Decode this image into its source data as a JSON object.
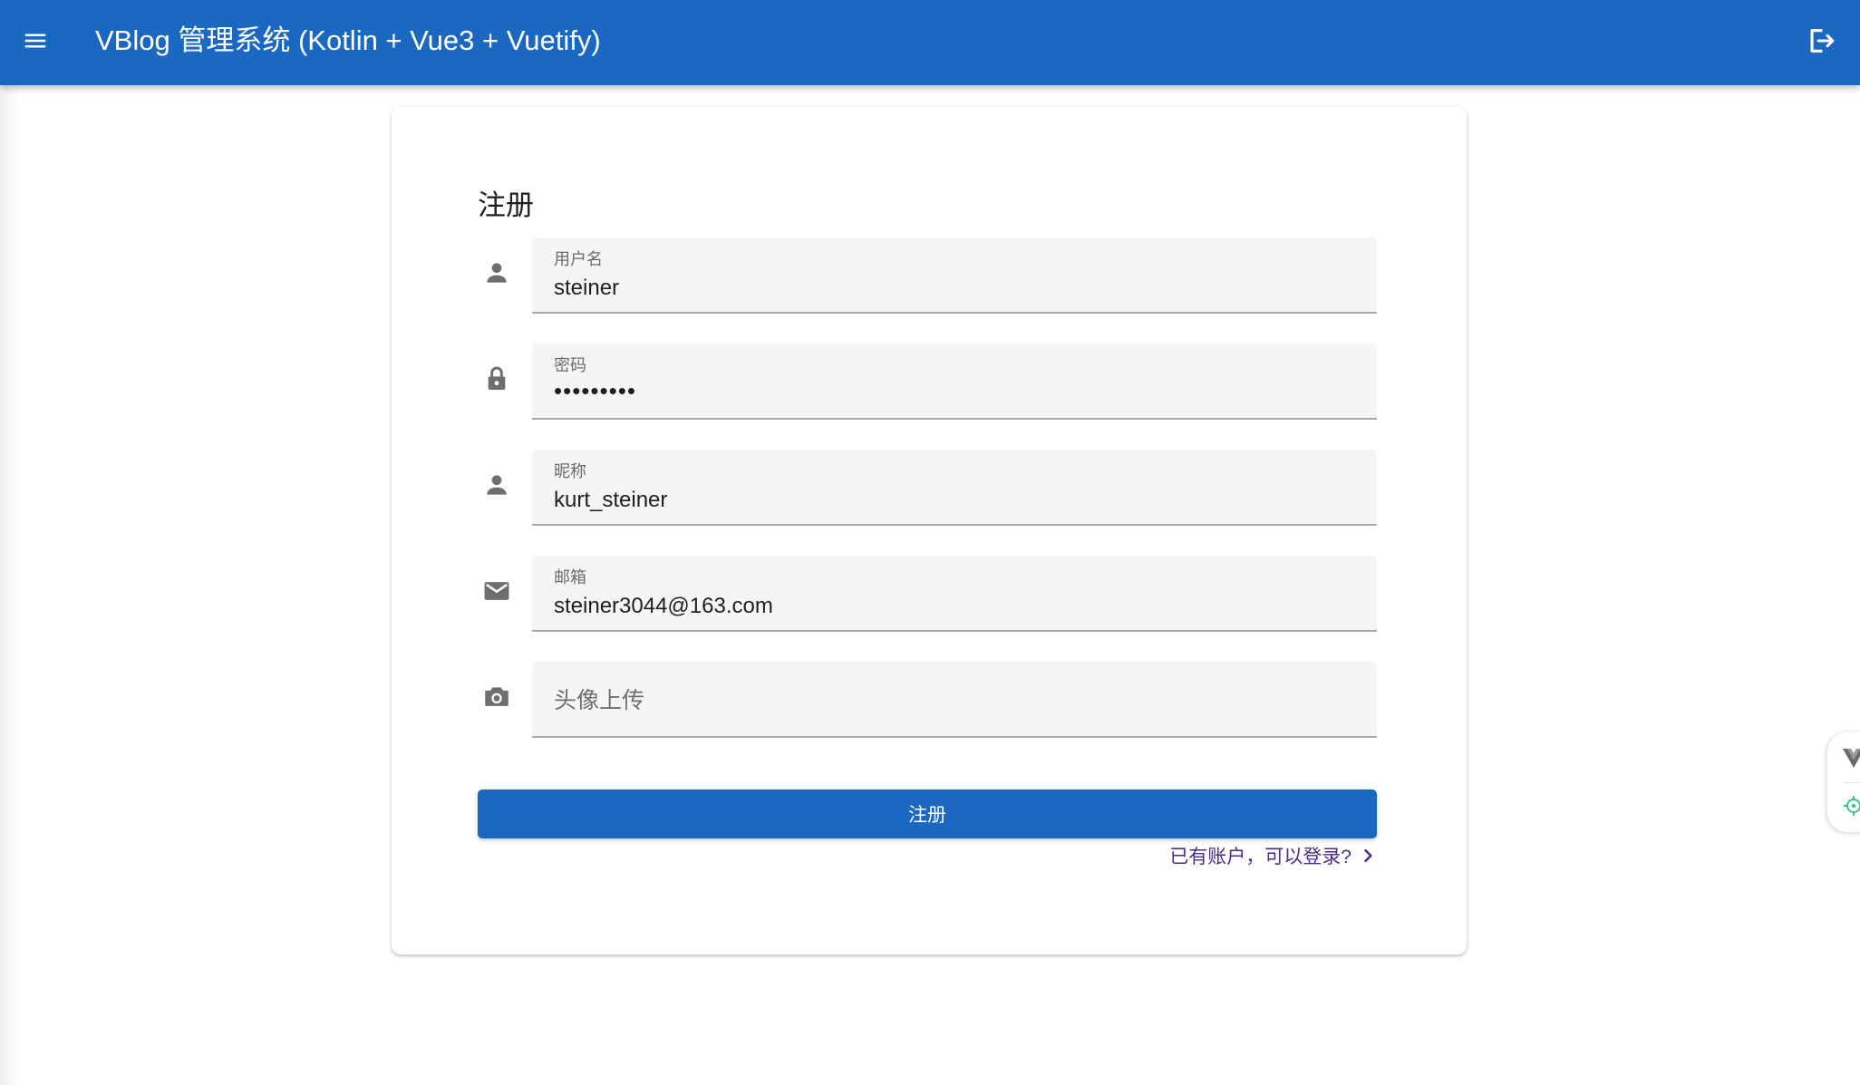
{
  "app_bar": {
    "title": "VBlog 管理系统 (Kotlin + Vue3 + Vuetify)",
    "menu_icon": "menu-icon",
    "logout_icon": "logout-icon",
    "color": "#1a68c2"
  },
  "form": {
    "title": "注册",
    "fields": [
      {
        "icon": "account-icon",
        "label": "用户名",
        "value": "steiner"
      },
      {
        "icon": "lock-icon",
        "label": "密码",
        "value": "•••••••••"
      },
      {
        "icon": "account-icon",
        "label": "昵称",
        "value": "kurt_steiner"
      },
      {
        "icon": "email-icon",
        "label": "邮箱",
        "value": "steiner3044@163.com"
      },
      {
        "icon": "camera-icon",
        "placeholder": "头像上传"
      }
    ],
    "submit_label": "注册",
    "login_link": "已有账户，可以登录?",
    "login_link_icon": "chevron-right-icon"
  },
  "side_widget": {
    "icons": [
      "vue-devtools-icon",
      "crosshair-icon"
    ]
  }
}
